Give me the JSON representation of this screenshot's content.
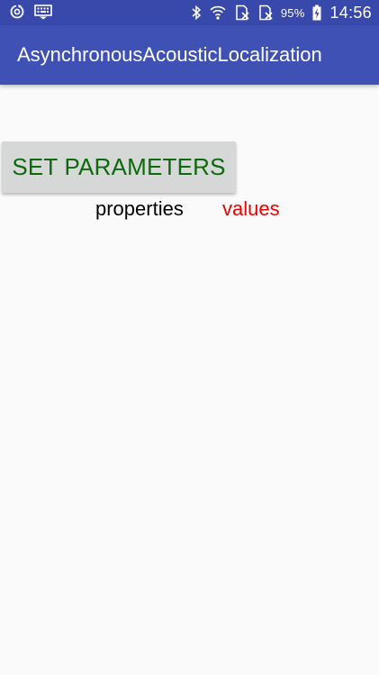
{
  "status_bar": {
    "left_icons": [
      "sync-icon",
      "keyboard-icon"
    ],
    "right_icons": [
      "bluetooth-icon",
      "wifi-icon",
      "no-sim-icon",
      "no-sim-icon",
      "battery-icon"
    ],
    "battery_percent": "95%",
    "time": "14:56"
  },
  "app_bar": {
    "title": "AsynchronousAcousticLocalization"
  },
  "main": {
    "set_parameters_label": "SET PARAMETERS",
    "properties_label": "properties",
    "values_label": "values"
  },
  "colors": {
    "status_bar": "#3949ab",
    "app_bar": "#3f51b5",
    "button_text": "#0b6b0b",
    "values_text": "#ee0000"
  }
}
